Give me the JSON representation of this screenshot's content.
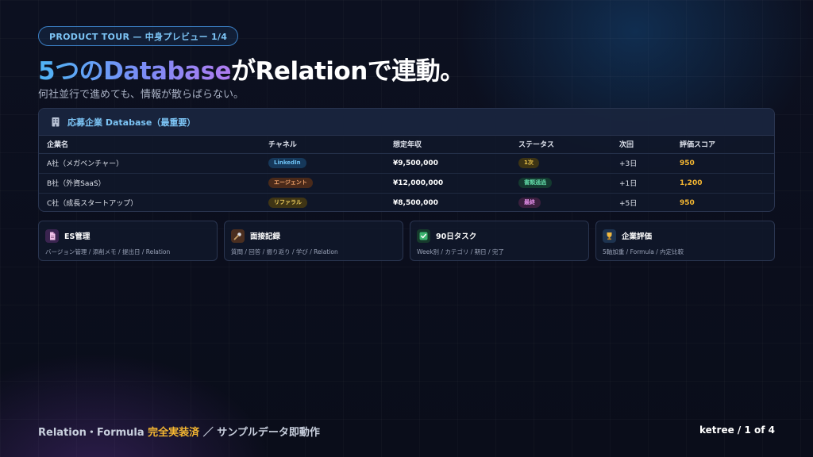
{
  "badge": {
    "label": "PRODUCT TOUR — 中身プレビュー 1/4"
  },
  "hero": {
    "title_gradient": "5つのDatabase",
    "title_plain": "がRelationで連動。",
    "subtitle": "何社並行で進めても、情報が散らばらない。"
  },
  "database": {
    "icon": "building-icon",
    "title": "応募企業 Database（最重要）",
    "columns": [
      "企業名",
      "チャネル",
      "想定年収",
      "ステータス",
      "次回",
      "評価スコア"
    ],
    "rows": [
      {
        "company": "A社（メガベンチャー）",
        "channel": "LinkedIn",
        "salary": "¥9,500,000",
        "status": "1次",
        "next": "+3日",
        "score": "950"
      },
      {
        "company": "B社（外資SaaS）",
        "channel": "エージェント",
        "salary": "¥12,000,000",
        "status": "書類通過",
        "next": "+1日",
        "score": "1,200"
      },
      {
        "company": "C社（成長スタートアップ）",
        "channel": "リファラル",
        "salary": "¥8,500,000",
        "status": "最終",
        "next": "+5日",
        "score": "950"
      }
    ]
  },
  "features": [
    {
      "icon": "document-icon",
      "title": "ES管理",
      "desc": "バージョン管理 / 添削メモ / 提出日 / Relation"
    },
    {
      "icon": "microphone-icon",
      "title": "面接記録",
      "desc": "質問 / 回答 / 振り返り / 学び / Relation"
    },
    {
      "icon": "checkbox-icon",
      "title": "90日タスク",
      "desc": "Week別 / カテゴリ / 期日 / 完了"
    },
    {
      "icon": "trophy-icon",
      "title": "企業評価",
      "desc": "5軸加重 / Formula / 内定比較"
    }
  ],
  "footer": {
    "left_prefix": "Relation・Formula ",
    "left_highlight": "完全実装済",
    "left_suffix": " ／ サンプルデータ即動作",
    "right": "ketree / 1 of 4"
  },
  "colors": {
    "accent_blue": "#7cc4f5",
    "accent_gold": "#f5b731",
    "background": "#0b0f1e"
  }
}
